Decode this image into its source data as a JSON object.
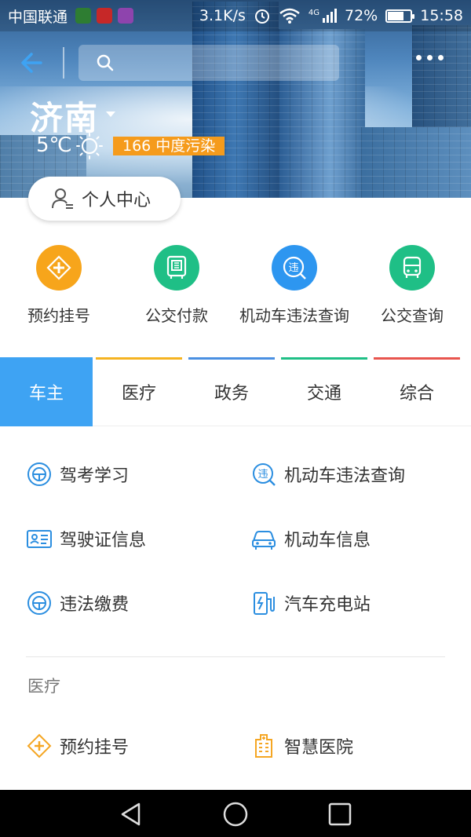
{
  "status_bar": {
    "carrier": "中国联通",
    "speed": "3.1K/s",
    "network": "4G",
    "battery": "72%",
    "battery_level": 0.72,
    "time": "15:58"
  },
  "header": {
    "city": "济南",
    "temperature": "5℃",
    "air_quality": "166 中度污染",
    "personal_center": "个人中心"
  },
  "quick_actions": [
    {
      "label": "预约挂号",
      "icon": "hospital-cross-icon",
      "color": "#f7a51b"
    },
    {
      "label": "公交付款",
      "icon": "qr-bus-icon",
      "color": "#1fbf86"
    },
    {
      "label": "机动车违法查询",
      "icon": "violation-search-icon",
      "color": "#2d96f0"
    },
    {
      "label": "公交查询",
      "icon": "bus-icon",
      "color": "#1fbf86"
    }
  ],
  "tabs": [
    {
      "label": "车主",
      "line_color": "#3ea3f3"
    },
    {
      "label": "医疗",
      "line_color": "#f5b321"
    },
    {
      "label": "政务",
      "line_color": "#4a90e2"
    },
    {
      "label": "交通",
      "line_color": "#1fbf86"
    },
    {
      "label": "综合",
      "line_color": "#e8554e"
    }
  ],
  "car_owner_services": [
    {
      "label": "驾考学习",
      "icon": "steering-wheel-icon"
    },
    {
      "label": "机动车违法查询",
      "icon": "violation-search-icon"
    },
    {
      "label": "驾驶证信息",
      "icon": "license-card-icon"
    },
    {
      "label": "机动车信息",
      "icon": "car-icon"
    },
    {
      "label": "违法缴费",
      "icon": "steering-wheel-icon"
    },
    {
      "label": "汽车充电站",
      "icon": "charging-station-icon"
    }
  ],
  "medical": {
    "title": "医疗",
    "services": [
      {
        "label": "预约挂号",
        "icon": "hospital-cross-icon"
      },
      {
        "label": "智慧医院",
        "icon": "hospital-building-icon"
      }
    ]
  },
  "colors": {
    "accent_blue": "#3ea3f3",
    "service_icon_blue": "#2b8ee0",
    "medical_icon_orange": "#f5a623"
  }
}
